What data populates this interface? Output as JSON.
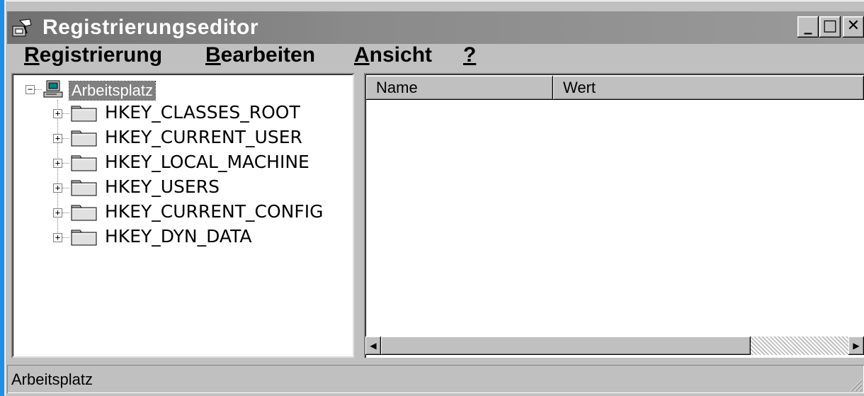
{
  "window": {
    "title": "Registrierungseditor",
    "title_icon": "registry-editor-icon",
    "controls": {
      "minimize": "_",
      "maximize": "□",
      "close": "✕"
    }
  },
  "menu": {
    "items": [
      {
        "accel": "R",
        "rest": "egistrierung"
      },
      {
        "accel": "B",
        "rest": "earbeiten"
      },
      {
        "accel": "A",
        "rest": "nsicht"
      },
      {
        "accel": "?",
        "rest": ""
      }
    ]
  },
  "tree": {
    "root": {
      "label": "Arbeitsplatz",
      "icon": "computer-icon",
      "expander": "−"
    },
    "keys": [
      {
        "label": "HKEY_CLASSES_ROOT",
        "expander": "+"
      },
      {
        "label": "HKEY_CURRENT_USER",
        "expander": "+"
      },
      {
        "label": "HKEY_LOCAL_MACHINE",
        "expander": "+"
      },
      {
        "label": "HKEY_USERS",
        "expander": "+"
      },
      {
        "label": "HKEY_CURRENT_CONFIG",
        "expander": "+"
      },
      {
        "label": "HKEY_DYN_DATA",
        "expander": "+"
      }
    ]
  },
  "list": {
    "columns": [
      "Name",
      "Wert"
    ],
    "scroll": {
      "left": "◀",
      "right": "▶"
    }
  },
  "status": {
    "text": "Arbeitsplatz"
  },
  "colors": {
    "titlebar": "#808080",
    "face": "#c0c0c0",
    "window": "#ffffff",
    "selection": "#808080",
    "desktop_edge": "#1e8ee6"
  }
}
